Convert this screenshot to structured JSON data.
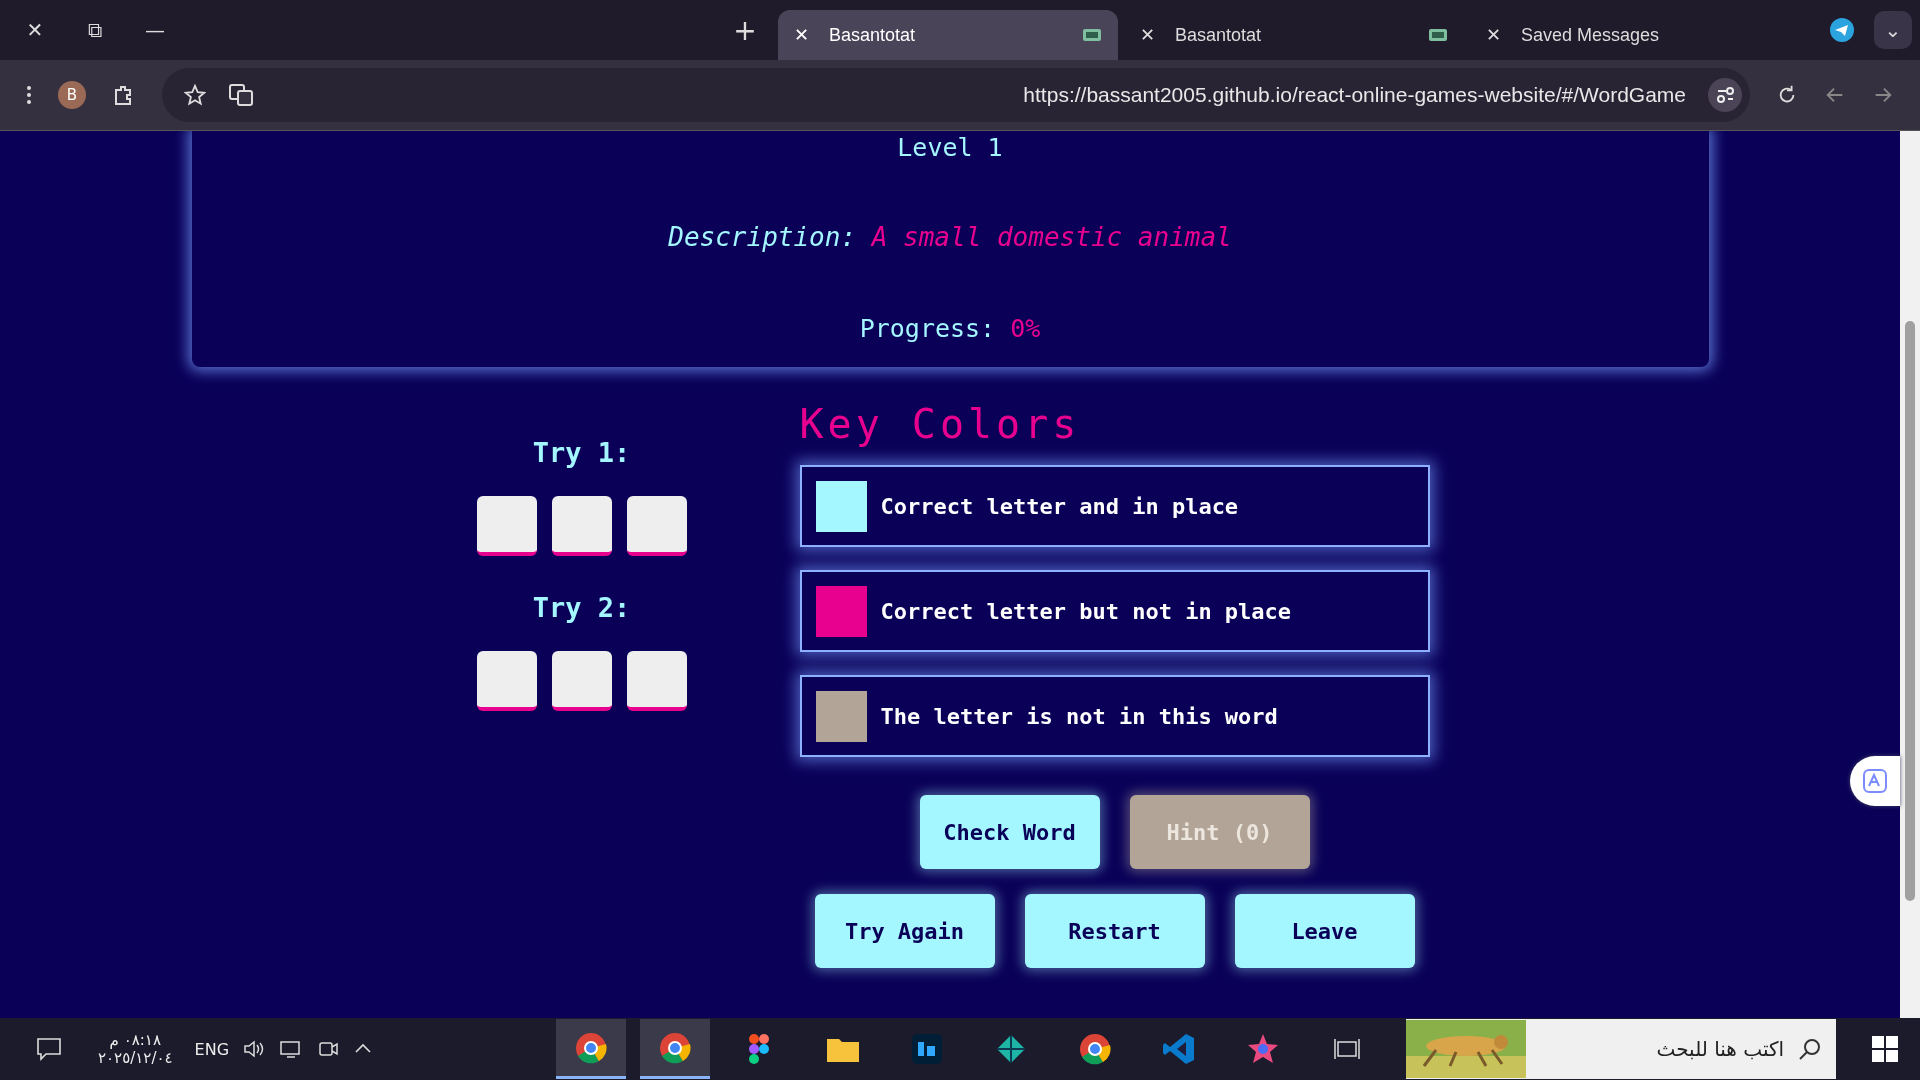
{
  "window_controls": {
    "close": "✕",
    "restore": "⧉",
    "minimize": "—"
  },
  "new_tab": "+",
  "tabs": [
    {
      "title": "Basantotat",
      "selected": true,
      "close": "✕"
    },
    {
      "title": "Basantotat",
      "selected": false,
      "close": "✕"
    },
    {
      "title": "Saved Messages",
      "selected": false,
      "close": "✕"
    }
  ],
  "tab_menu": "⌄",
  "toolbar": {
    "profile": "B",
    "url": "https://bassant2005.github.io/react-online-games-website/#/WordGame"
  },
  "game": {
    "level": "Level 1",
    "description_label": "Description:",
    "description": "A small domestic animal",
    "progress_label": "Progress:",
    "progress": "0%",
    "tries": [
      {
        "label": "Try 1:",
        "tiles": [
          {
            "filled": false
          },
          {
            "filled": false
          },
          {
            "filled": false
          }
        ]
      },
      {
        "label": "Try 2:",
        "tiles": [
          {
            "filled": false
          },
          {
            "filled": false
          },
          {
            "filled": false
          }
        ]
      }
    ],
    "key_colors_title": "Key Colors",
    "key_colors": [
      {
        "label": "Correct letter and in place",
        "color": "#a4f6ff"
      },
      {
        "label": "Correct letter but not in place",
        "color": "#e8008f"
      },
      {
        "label": "The letter is not in this word",
        "color": "#b2a597"
      }
    ],
    "action_rows": [
      [
        {
          "label": "Check Word",
          "disabled": false
        },
        {
          "label": "Hint (0)",
          "disabled": true
        }
      ],
      [
        {
          "label": "Try Again",
          "disabled": false
        },
        {
          "label": "Restart",
          "disabled": false
        },
        {
          "label": "Leave",
          "disabled": false
        }
      ]
    ]
  },
  "taskbar": {
    "time": "٠٨:١٨ م",
    "date": "٢٠٢٥/١٢/٠٤",
    "language": "ENG",
    "search_placeholder": "اكتب هنا للبحث"
  }
}
